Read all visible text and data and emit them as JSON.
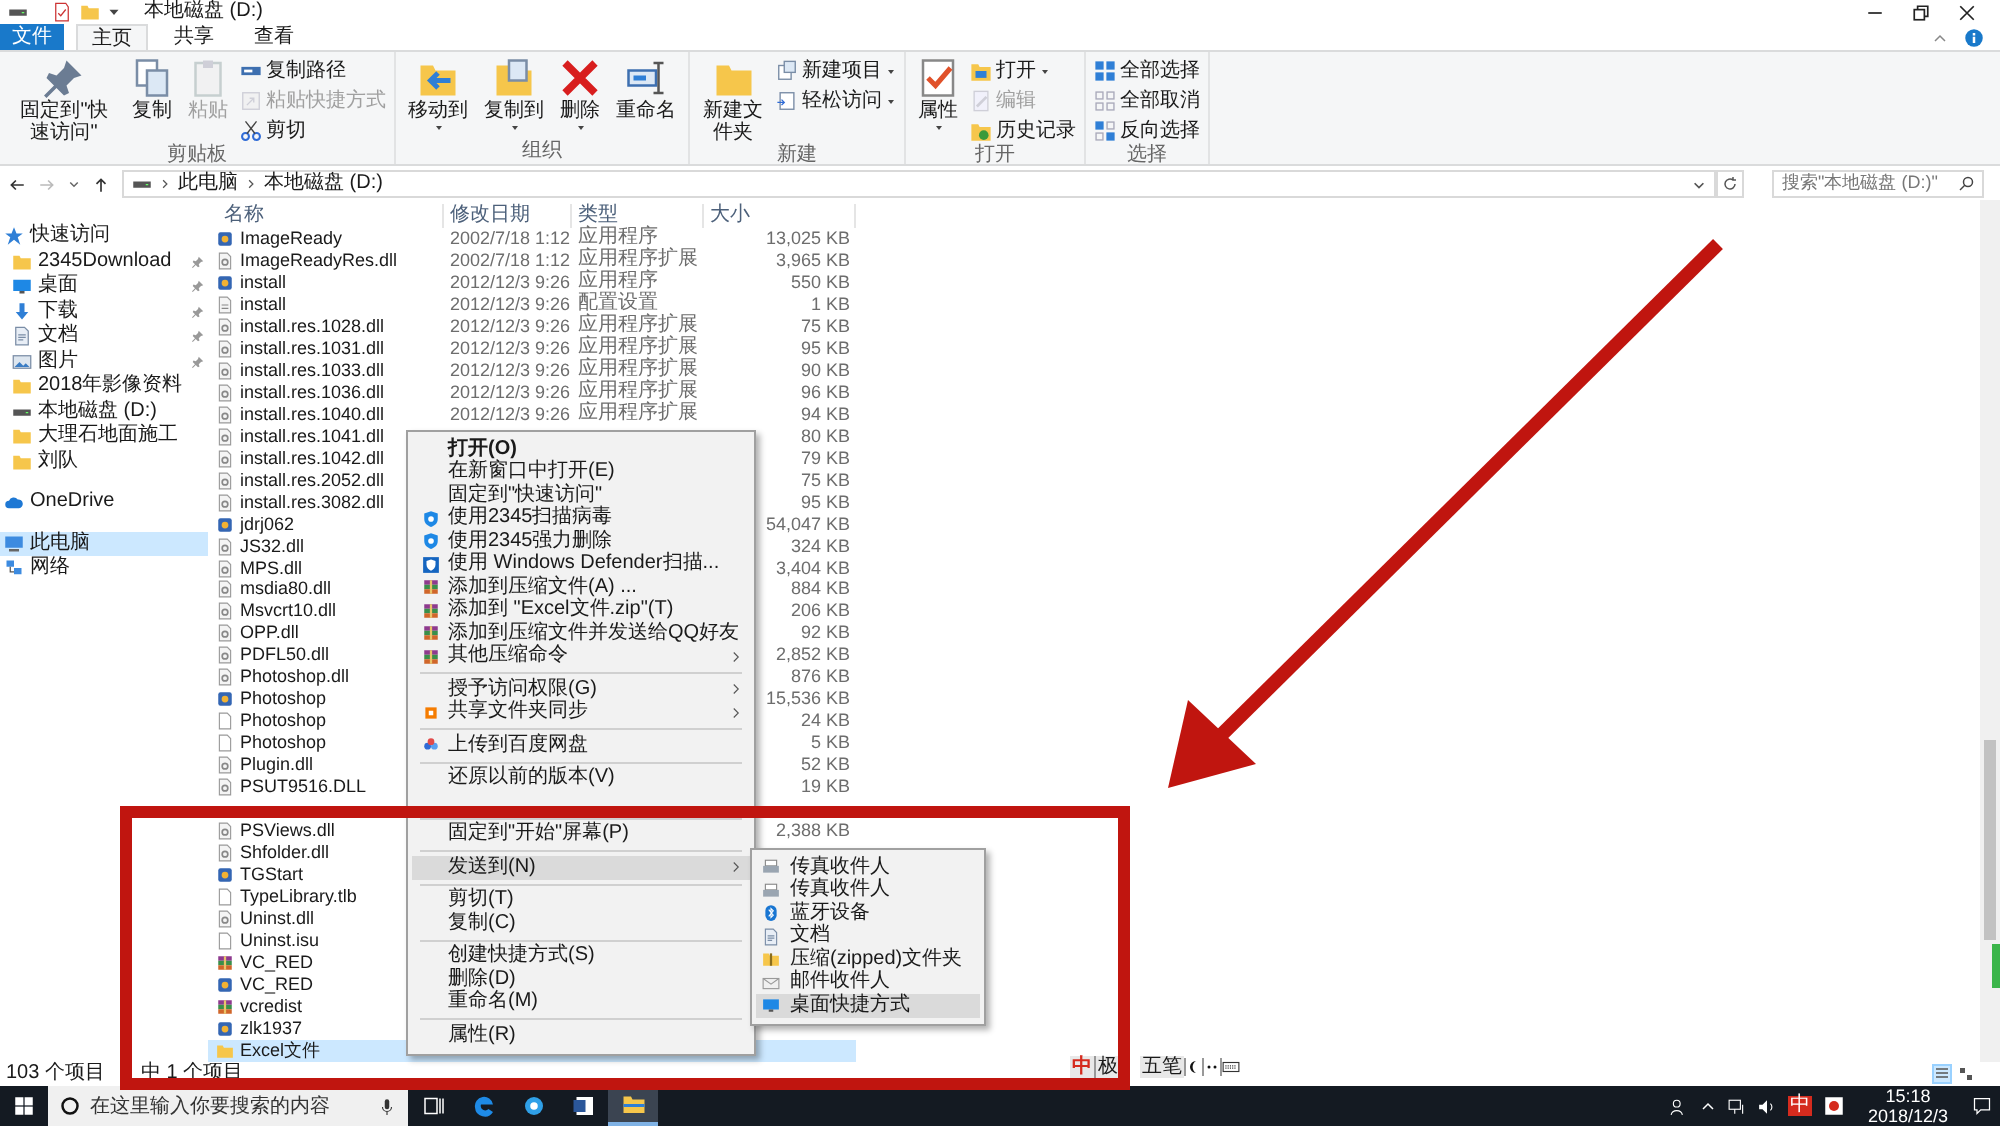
{
  "window": {
    "title": "本地磁盘 (D:)"
  },
  "ribbon_tabs": [
    {
      "label": "文件",
      "kind": "file",
      "selected": false
    },
    {
      "label": "主页",
      "kind": "tab",
      "selected": true
    },
    {
      "label": "共享",
      "kind": "tab",
      "selected": false
    },
    {
      "label": "查看",
      "kind": "tab",
      "selected": false
    }
  ],
  "ribbon_groups": [
    {
      "label": "剪贴板",
      "big": [
        {
          "label": "固定到\"快速访问\"",
          "kind": "pin",
          "disabled": false,
          "dropdown": false
        },
        {
          "label": "复制",
          "kind": "copy",
          "disabled": false,
          "dropdown": false
        },
        {
          "label": "粘贴",
          "kind": "paste",
          "disabled": true,
          "dropdown": false
        }
      ],
      "small": [
        {
          "label": "复制路径",
          "kind": "path",
          "disabled": false,
          "dropdown": false
        },
        {
          "label": "粘贴快捷方式",
          "kind": "shortcut",
          "disabled": true,
          "dropdown": false
        },
        {
          "label": "剪切",
          "kind": "cut",
          "disabled": false,
          "dropdown": false
        }
      ]
    },
    {
      "label": "组织",
      "big": [
        {
          "label": "移动到",
          "kind": "move",
          "disabled": false,
          "dropdown": true
        },
        {
          "label": "复制到",
          "kind": "copyto",
          "disabled": false,
          "dropdown": true
        },
        {
          "label": "删除",
          "kind": "delete",
          "disabled": false,
          "dropdown": true
        },
        {
          "label": "重命名",
          "kind": "rename",
          "disabled": false,
          "dropdown": false
        }
      ]
    },
    {
      "label": "新建",
      "big": [
        {
          "label": "新建文件夹",
          "kind": "newfolder",
          "disabled": false,
          "dropdown": false
        }
      ],
      "small": [
        {
          "label": "新建项目",
          "kind": "newitem",
          "disabled": false,
          "dropdown": true
        },
        {
          "label": "轻松访问",
          "kind": "access",
          "disabled": false,
          "dropdown": true
        }
      ]
    },
    {
      "label": "打开",
      "big": [
        {
          "label": "属性",
          "kind": "properties",
          "disabled": false,
          "dropdown": true
        }
      ],
      "small": [
        {
          "label": "打开",
          "kind": "open",
          "disabled": false,
          "dropdown": true
        },
        {
          "label": "编辑",
          "kind": "edit",
          "disabled": true,
          "dropdown": false
        },
        {
          "label": "历史记录",
          "kind": "history",
          "disabled": false,
          "dropdown": false
        }
      ]
    },
    {
      "label": "选择",
      "small": [
        {
          "label": "全部选择",
          "kind": "selectall",
          "disabled": false,
          "dropdown": false
        },
        {
          "label": "全部取消",
          "kind": "selectnone",
          "disabled": false,
          "dropdown": false
        },
        {
          "label": "反向选择",
          "kind": "invert",
          "disabled": false,
          "dropdown": false
        }
      ]
    }
  ],
  "address": {
    "path": [
      "此电脑",
      "本地磁盘 (D:)"
    ],
    "search_placeholder": "搜索\"本地磁盘 (D:)\""
  },
  "sidebar": [
    [
      {
        "label": "快速访问",
        "kind": "star",
        "pinned": false,
        "selected": false
      },
      {
        "label": "2345Download",
        "kind": "folder",
        "pinned": true,
        "selected": false
      },
      {
        "label": "桌面",
        "kind": "desktop",
        "pinned": true,
        "selected": false
      },
      {
        "label": "下载",
        "kind": "download",
        "pinned": true,
        "selected": false
      },
      {
        "label": "文档",
        "kind": "document",
        "pinned": true,
        "selected": false
      },
      {
        "label": "图片",
        "kind": "pictures",
        "pinned": true,
        "selected": false
      },
      {
        "label": "2018年影像资料",
        "kind": "folder",
        "pinned": false,
        "selected": false
      },
      {
        "label": "本地磁盘 (D:)",
        "kind": "drive",
        "pinned": false,
        "selected": false
      },
      {
        "label": "大理石地面施工",
        "kind": "folder",
        "pinned": false,
        "selected": false
      },
      {
        "label": "刘队",
        "kind": "folder",
        "pinned": false,
        "selected": false
      }
    ],
    [
      {
        "label": "OneDrive",
        "kind": "cloud",
        "pinned": false,
        "selected": false
      }
    ],
    [
      {
        "label": "此电脑",
        "kind": "computer",
        "pinned": false,
        "selected": true
      },
      {
        "label": "网络",
        "kind": "network",
        "pinned": false,
        "selected": false
      }
    ]
  ],
  "columns": [
    "名称",
    "修改日期",
    "类型",
    "大小"
  ],
  "files": [
    {
      "name": "ImageReady",
      "date": "2002/7/18 1:12",
      "type": "应用程序",
      "size": "13,025 KB",
      "kind": "app",
      "selected": false
    },
    {
      "name": "ImageReadyRes.dll",
      "date": "2002/7/18 1:12",
      "type": "应用程序扩展",
      "size": "3,965 KB",
      "kind": "dll",
      "selected": false
    },
    {
      "name": "install",
      "date": "2012/12/3 9:26",
      "type": "应用程序",
      "size": "550 KB",
      "kind": "app",
      "selected": false
    },
    {
      "name": "install",
      "date": "2012/12/3 9:26",
      "type": "配置设置",
      "size": "1 KB",
      "kind": "config",
      "selected": false
    },
    {
      "name": "install.res.1028.dll",
      "date": "2012/12/3 9:26",
      "type": "应用程序扩展",
      "size": "75 KB",
      "kind": "dll",
      "selected": false
    },
    {
      "name": "install.res.1031.dll",
      "date": "2012/12/3 9:26",
      "type": "应用程序扩展",
      "size": "95 KB",
      "kind": "dll",
      "selected": false
    },
    {
      "name": "install.res.1033.dll",
      "date": "2012/12/3 9:26",
      "type": "应用程序扩展",
      "size": "90 KB",
      "kind": "dll",
      "selected": false
    },
    {
      "name": "install.res.1036.dll",
      "date": "2012/12/3 9:26",
      "type": "应用程序扩展",
      "size": "96 KB",
      "kind": "dll",
      "selected": false
    },
    {
      "name": "install.res.1040.dll",
      "date": "2012/12/3 9:26",
      "type": "应用程序扩展",
      "size": "94 KB",
      "kind": "dll",
      "selected": false
    },
    {
      "name": "install.res.1041.dll",
      "size": "80 KB",
      "kind": "dll",
      "selected": false
    },
    {
      "name": "install.res.1042.dll",
      "size": "79 KB",
      "kind": "dll",
      "selected": false
    },
    {
      "name": "install.res.2052.dll",
      "size": "75 KB",
      "kind": "dll",
      "selected": false
    },
    {
      "name": "install.res.3082.dll",
      "size": "95 KB",
      "kind": "dll",
      "selected": false
    },
    {
      "name": "jdrj062",
      "size": "54,047 KB",
      "kind": "app",
      "selected": false
    },
    {
      "name": "JS32.dll",
      "size": "324 KB",
      "kind": "dll",
      "selected": false
    },
    {
      "name": "MPS.dll",
      "size": "3,404 KB",
      "kind": "dll",
      "selected": false
    },
    {
      "name": "msdia80.dll",
      "size": "884 KB",
      "kind": "dll",
      "selected": false
    },
    {
      "name": "Msvcrt10.dll",
      "size": "206 KB",
      "kind": "dll",
      "selected": false
    },
    {
      "name": "OPP.dll",
      "size": "92 KB",
      "kind": "dll",
      "selected": false
    },
    {
      "name": "PDFL50.dll",
      "size": "2,852 KB",
      "kind": "dll",
      "selected": false
    },
    {
      "name": "Photoshop.dll",
      "size": "876 KB",
      "kind": "dll",
      "selected": false
    },
    {
      "name": "Photoshop",
      "size": "15,536 KB",
      "kind": "app",
      "selected": false
    },
    {
      "name": "Photoshop",
      "size": "24 KB",
      "kind": "file",
      "selected": false
    },
    {
      "name": "Photoshop",
      "size": "5 KB",
      "kind": "file",
      "selected": false
    },
    {
      "name": "Plugin.dll",
      "size": "52 KB",
      "kind": "dll",
      "selected": false
    },
    {
      "name": "PSUT9516.DLL",
      "size": "19 KB",
      "kind": "dll",
      "selected": false
    },
    {
      "kind": "hidden",
      "selected": false
    },
    {
      "name": "PSViews.dll",
      "size": "2,388 KB",
      "kind": "dll",
      "selected": false
    },
    {
      "name": "Shfolder.dll",
      "kind": "dll",
      "selected": false
    },
    {
      "name": "TGStart",
      "kind": "app",
      "selected": false
    },
    {
      "name": "TypeLibrary.tlb",
      "kind": "file",
      "selected": false
    },
    {
      "name": "Uninst.dll",
      "kind": "dll",
      "selected": false
    },
    {
      "name": "Uninst.isu",
      "kind": "file",
      "selected": false
    },
    {
      "name": "VC_RED",
      "kind": "archive",
      "selected": false
    },
    {
      "name": "VC_RED",
      "kind": "app",
      "selected": false
    },
    {
      "name": "vcredist",
      "kind": "archive",
      "selected": false
    },
    {
      "name": "zlk1937",
      "kind": "app",
      "selected": false
    },
    {
      "name": "Excel文件",
      "kind": "folder",
      "selected": true
    }
  ],
  "context_menu": [
    [
      {
        "label": "打开(O)",
        "kind": "plain",
        "bold": true,
        "arrow": false,
        "selected": false
      },
      {
        "label": "在新窗口中打开(E)",
        "kind": "plain",
        "bold": false,
        "arrow": false,
        "selected": false
      },
      {
        "label": "固定到\"快速访问\"",
        "kind": "plain",
        "bold": false,
        "arrow": false,
        "selected": false
      },
      {
        "label": "使用2345扫描病毒",
        "kind": "shield",
        "bold": false,
        "arrow": false,
        "selected": false
      },
      {
        "label": "使用2345强力删除",
        "kind": "shield",
        "bold": false,
        "arrow": false,
        "selected": false
      },
      {
        "label": "使用 Windows Defender扫描...",
        "kind": "defender",
        "bold": false,
        "arrow": false,
        "selected": false
      },
      {
        "label": "添加到压缩文件(A) ...",
        "kind": "archive",
        "bold": false,
        "arrow": false,
        "selected": false
      },
      {
        "label": "添加到 \"Excel文件.zip\"(T)",
        "kind": "archive",
        "bold": false,
        "arrow": false,
        "selected": false
      },
      {
        "label": "添加到压缩文件并发送给QQ好友",
        "kind": "archive",
        "bold": false,
        "arrow": false,
        "selected": false
      },
      {
        "label": "其他压缩命令",
        "kind": "archive",
        "bold": false,
        "arrow": true,
        "selected": false
      }
    ],
    [
      {
        "label": "授予访问权限(G)",
        "kind": "plain",
        "bold": false,
        "arrow": true,
        "selected": false
      },
      {
        "label": "共享文件夹同步",
        "kind": "sync",
        "bold": false,
        "arrow": true,
        "selected": false
      }
    ],
    [
      {
        "label": "上传到百度网盘",
        "kind": "cloud",
        "bold": false,
        "arrow": false,
        "selected": false
      }
    ],
    [
      {
        "label": "还原以前的版本(V)",
        "kind": "plain",
        "bold": false,
        "arrow": false,
        "selected": false
      },
      {
        "kind": "hidden"
      }
    ],
    [
      {
        "label": "固定到\"开始\"屏幕(P)",
        "kind": "plain",
        "bold": false,
        "arrow": false,
        "selected": false
      }
    ],
    [
      {
        "label": "发送到(N)",
        "kind": "plain",
        "bold": false,
        "arrow": true,
        "selected": true
      }
    ],
    [
      {
        "label": "剪切(T)",
        "kind": "plain",
        "bold": false,
        "arrow": false,
        "selected": false
      },
      {
        "label": "复制(C)",
        "kind": "plain",
        "bold": false,
        "arrow": false,
        "selected": false
      }
    ],
    [
      {
        "label": "创建快捷方式(S)",
        "kind": "plain",
        "bold": false,
        "arrow": false,
        "selected": false
      },
      {
        "label": "删除(D)",
        "kind": "plain",
        "bold": false,
        "arrow": false,
        "selected": false
      },
      {
        "label": "重命名(M)",
        "kind": "plain",
        "bold": false,
        "arrow": false,
        "selected": false
      }
    ],
    [
      {
        "label": "属性(R)",
        "kind": "plain",
        "bold": false,
        "arrow": false,
        "selected": false
      }
    ]
  ],
  "send_to_menu": [
    {
      "label": "传真收件人",
      "kind": "fax",
      "selected": false
    },
    {
      "label": "传真收件人",
      "kind": "fax",
      "selected": false
    },
    {
      "label": "蓝牙设备",
      "kind": "bluetooth",
      "selected": false
    },
    {
      "label": "文档",
      "kind": "document",
      "selected": false
    },
    {
      "label": "压缩(zipped)文件夹",
      "kind": "zip",
      "selected": false
    },
    {
      "label": "邮件收件人",
      "kind": "mail",
      "selected": false
    },
    {
      "label": "桌面快捷方式",
      "kind": "desktop",
      "selected": true
    }
  ],
  "status_bar": {
    "item_count": "103 个项目",
    "selection": "中 1 个项目",
    "views": [
      {
        "kind": "details",
        "selected": true
      },
      {
        "kind": "tiles",
        "selected": false
      }
    ]
  },
  "ime_bar": {
    "mode": "中",
    "name": "极",
    "layout": "五笔"
  },
  "taskbar": {
    "search_placeholder": "在这里输入你要搜索的内容",
    "apps": [
      {
        "kind": "taskview",
        "active": false
      },
      {
        "kind": "edge",
        "active": false
      },
      {
        "kind": "ie",
        "active": false
      },
      {
        "kind": "word",
        "active": false
      },
      {
        "kind": "explorer",
        "active": true
      }
    ],
    "ime": "中",
    "time": "15:18",
    "date": "2018/12/3"
  }
}
